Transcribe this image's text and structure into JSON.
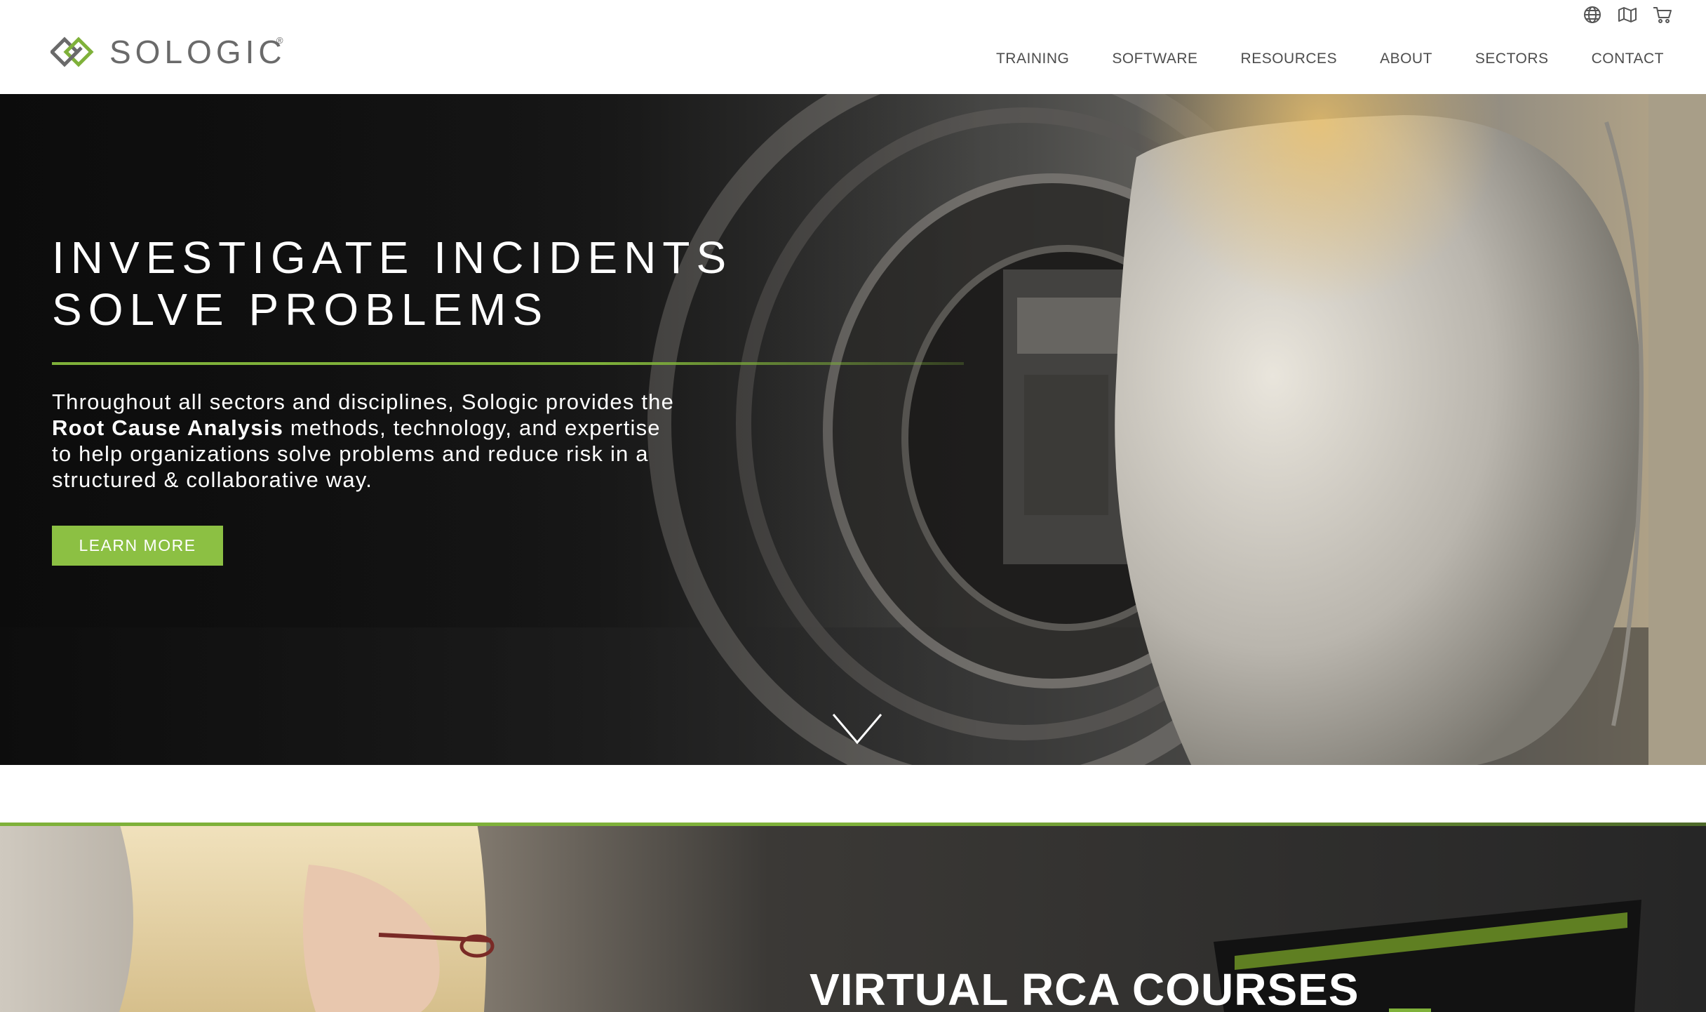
{
  "header": {
    "logo_text": "SOLOGIC",
    "logo_registered": "®",
    "utility_icons": [
      "globe-icon",
      "map-icon",
      "cart-icon"
    ],
    "nav": [
      "TRAINING",
      "SOFTWARE",
      "RESOURCES",
      "ABOUT",
      "SECTORS",
      "CONTACT"
    ]
  },
  "hero": {
    "title_line1": "INVESTIGATE INCIDENTS",
    "title_line2": "SOLVE PROBLEMS",
    "copy_before": "Throughout all sectors and disciplines, Sologic provides the ",
    "copy_bold": "Root Cause Analysis",
    "copy_after": " methods, technology, and expertise to help organizations solve problems and reduce risk in a structured & collaborative way.",
    "button_label": "LEARN MORE",
    "scroll_icon": "chevron-down-icon"
  },
  "band": {
    "title": "VIRTUAL RCA COURSES"
  },
  "colors": {
    "accent_green": "#8cc043",
    "rule_green": "#7fb13a",
    "nav_text": "#4d4d4d",
    "logo_gray": "#6a6a6a"
  }
}
